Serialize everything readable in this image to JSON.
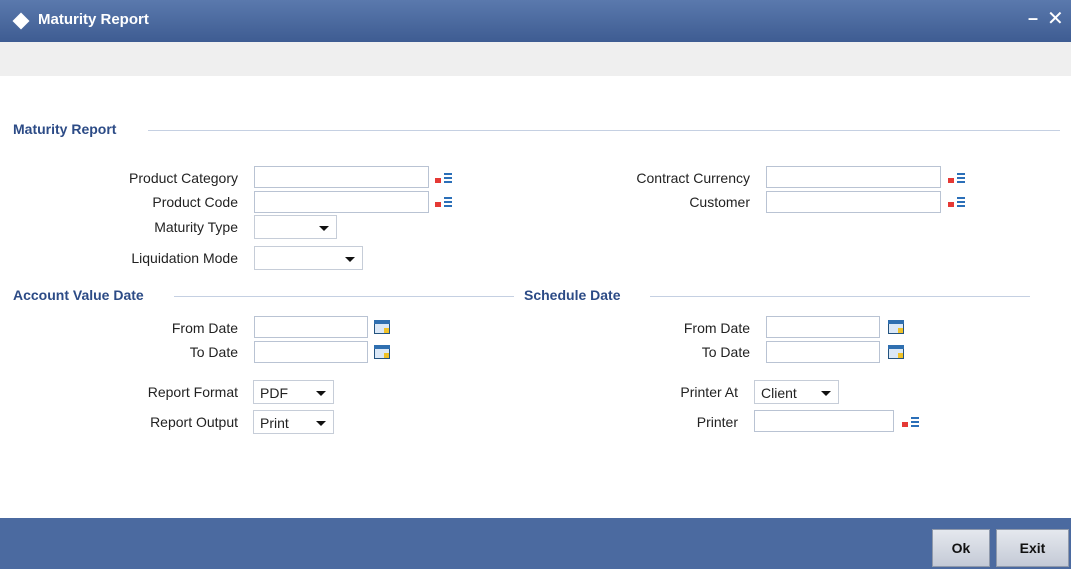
{
  "window": {
    "title": "Maturity Report",
    "minimize_symbol": "–",
    "close_symbol": "✕"
  },
  "sections": {
    "main": "Maturity Report",
    "account_value_date": "Account Value Date",
    "schedule_date": "Schedule Date"
  },
  "fields": {
    "product_category": {
      "label": "Product Category",
      "value": ""
    },
    "product_code": {
      "label": "Product Code",
      "value": ""
    },
    "maturity_type": {
      "label": "Maturity Type",
      "value": ""
    },
    "liquidation_mode": {
      "label": "Liquidation Mode",
      "value": ""
    },
    "contract_currency": {
      "label": "Contract Currency",
      "value": ""
    },
    "customer": {
      "label": "Customer",
      "value": ""
    },
    "account_from_date": {
      "label": "From Date",
      "value": ""
    },
    "account_to_date": {
      "label": "To Date",
      "value": ""
    },
    "schedule_from_date": {
      "label": "From Date",
      "value": ""
    },
    "schedule_to_date": {
      "label": "To Date",
      "value": ""
    },
    "report_format": {
      "label": "Report Format",
      "value": "PDF"
    },
    "report_output": {
      "label": "Report Output",
      "value": "Print"
    },
    "printer_at": {
      "label": "Printer At",
      "value": "Client"
    },
    "printer": {
      "label": "Printer",
      "value": ""
    }
  },
  "buttons": {
    "ok": "Ok",
    "exit": "Exit"
  },
  "colors": {
    "titlebar": "#4a6aa0",
    "section_heading": "#2c4b86",
    "footer": "#4b6aa0"
  },
  "icons": {
    "lov": "list-of-values-icon",
    "calendar": "calendar-icon",
    "dropdown": "chevron-down-icon"
  }
}
